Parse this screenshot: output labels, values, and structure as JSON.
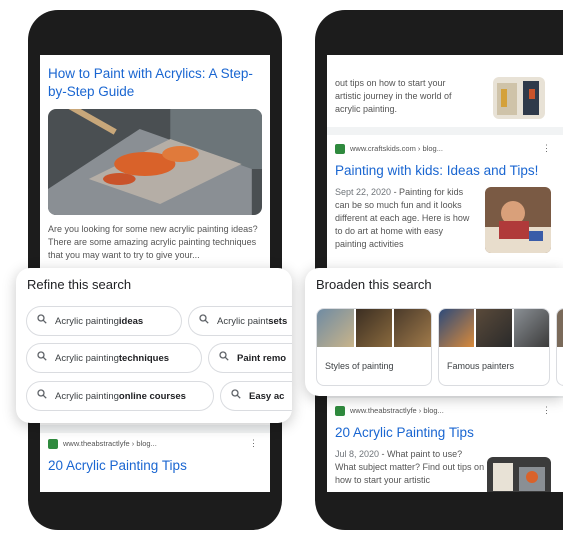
{
  "left_phone": {
    "top_result": {
      "title": "How to Paint with Acrylics: A Step-by-Step Guide",
      "snippet": "Are you looking for some new acrylic painting ideas? There are some amazing acrylic painting techniques that you may want to try to give your..."
    },
    "refine": {
      "title": "Refine this search",
      "chips": [
        {
          "prefix": "Acrylic painting ",
          "bold": "ideas"
        },
        {
          "prefix": "Acrylic paint ",
          "bold": "sets"
        },
        {
          "prefix": "Acrylic painting ",
          "bold": "techniques"
        },
        {
          "prefix": "",
          "bold": "Paint remo"
        },
        {
          "prefix": "Acrylic painting ",
          "bold": "online courses"
        },
        {
          "prefix": "",
          "bold": "Easy ac"
        }
      ]
    },
    "bottom_result": {
      "source": "www.theabstractlyfe › blog...",
      "title": "20 Acrylic Painting Tips"
    }
  },
  "right_phone": {
    "top_snippet": "out tips on how to start your artistic journey in the world of acrylic painting.",
    "middle_result": {
      "source": "www.craftskids.com › blog...",
      "title": "Painting with kids: Ideas and Tips!",
      "date": "Sept 22, 2020",
      "snippet": " - Painting for kids can be so much fun and it looks different at each age. Here is how to do art at home with easy painting activities"
    },
    "broaden": {
      "title": "Broaden this search",
      "cards": [
        {
          "label": "Styles of painting"
        },
        {
          "label": "Famous painters"
        }
      ]
    },
    "bottom_result": {
      "source": "www.theabstractlyfe › blog...",
      "title": "20 Acrylic Painting Tips",
      "date": "Jul 8, 2020",
      "snippet": " - What paint to use? What subject matter? Find out tips on how to start your artistic"
    }
  },
  "icons": {
    "kebab": "⋮"
  },
  "colors": {
    "link": "#1a66d1",
    "phone_frame": "#1c1c1c",
    "chip_border": "#dadce0"
  }
}
